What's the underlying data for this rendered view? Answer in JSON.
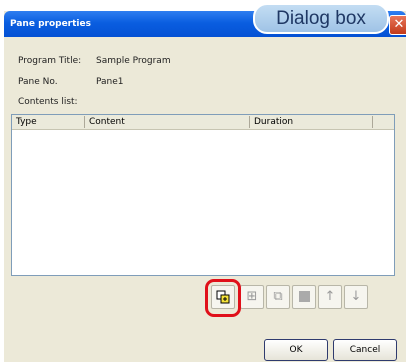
{
  "window": {
    "title": "Pane properties"
  },
  "callout": {
    "label": "Dialog box"
  },
  "fields": [
    {
      "label": "Program Title:",
      "value": "Sample Program"
    },
    {
      "label": "Pane No.",
      "value": "Pane1"
    }
  ],
  "contents": {
    "label": "Contents list:",
    "columns": [
      "Type",
      "Content",
      "Duration"
    ]
  },
  "toolbar": {
    "icons": [
      "add-content-icon",
      "insert-icon",
      "copy-icon",
      "delete-icon",
      "move-up-icon",
      "move-down-icon"
    ],
    "highlight_color": "#e0101a"
  },
  "buttons": {
    "ok": "OK",
    "cancel": "Cancel"
  },
  "colors": {
    "titlebar": "#0a5ee0",
    "dialog_bg": "#ece9d8"
  }
}
